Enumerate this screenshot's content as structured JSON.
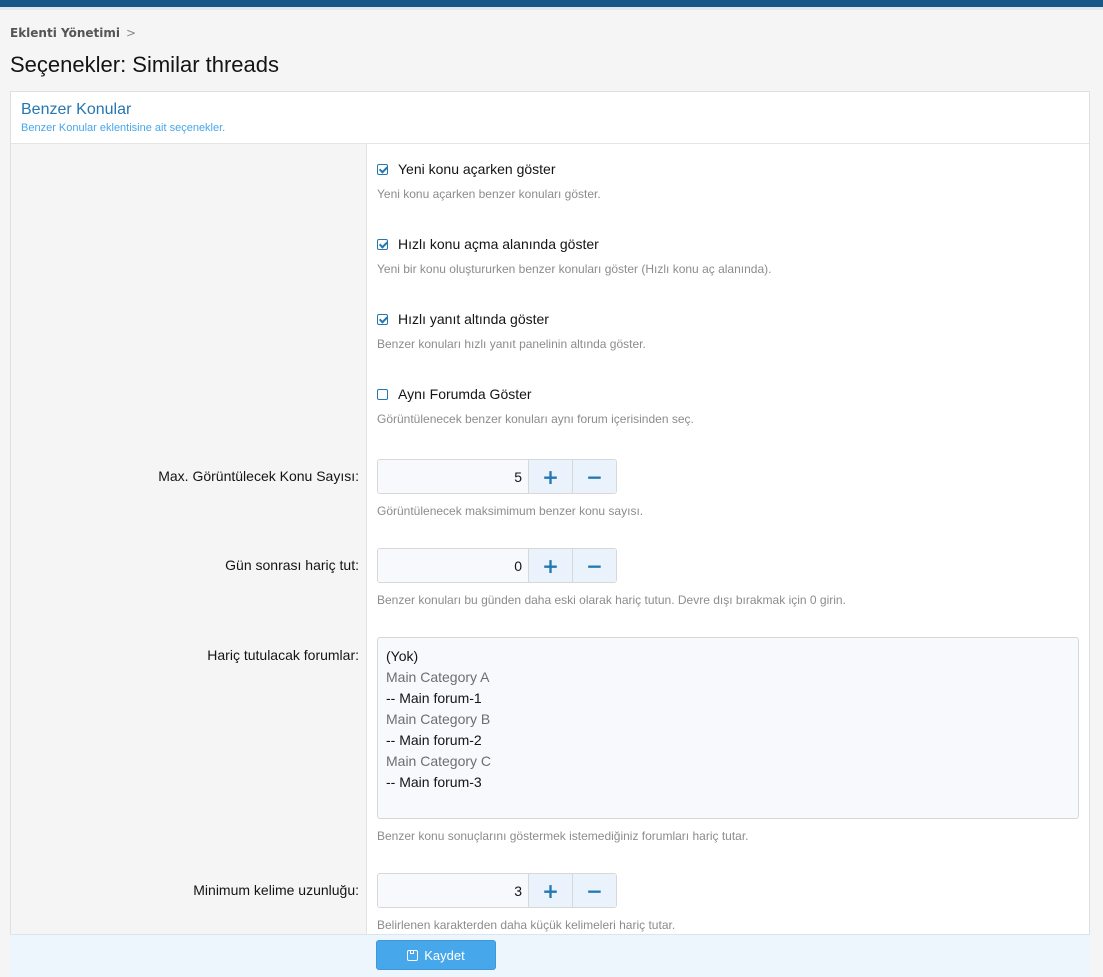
{
  "breadcrumb": {
    "item": "Eklenti Yönetimi",
    "separator": ">"
  },
  "page_title": "Seçenekler: Similar threads",
  "block": {
    "title": "Benzer Konular",
    "description": "Benzer Konular eklentisine ait seçenekler."
  },
  "checkboxes": [
    {
      "label": "Yeni konu açarken göster",
      "hint": "Yeni konu açarken benzer konuları göster.",
      "checked": true
    },
    {
      "label": "Hızlı konu açma alanında göster",
      "hint": "Yeni bir konu oluştururken benzer konuları göster (Hızlı konu aç alanında).",
      "checked": true
    },
    {
      "label": "Hızlı yanıt altında göster",
      "hint": "Benzer konuları hızlı yanıt panelinin altında göster.",
      "checked": true
    },
    {
      "label": "Aynı Forumda Göster",
      "hint": "Görüntülenecek benzer konuları aynı forum içerisinden seç.",
      "checked": false
    }
  ],
  "max_threads": {
    "label": "Max. Görüntülecek Konu Sayısı:",
    "value": "5",
    "hint": "Görüntülenecek maksimimum benzer konu sayısı."
  },
  "days_exclude": {
    "label": "Gün sonrası hariç tut:",
    "value": "0",
    "hint": "Benzer konuları bu günden daha eski olarak hariç tutun. Devre dışı bırakmak için 0 girin."
  },
  "excluded_forums": {
    "label": "Hariç tutulacak forumlar:",
    "options": [
      {
        "text": "(Yok)",
        "kind": "item"
      },
      {
        "text": "Main Category A",
        "kind": "cat"
      },
      {
        "text": "-- Main forum-1",
        "kind": "item"
      },
      {
        "text": "Main Category B",
        "kind": "cat"
      },
      {
        "text": "-- Main forum-2",
        "kind": "item"
      },
      {
        "text": "Main Category C",
        "kind": "cat"
      },
      {
        "text": "-- Main forum-3",
        "kind": "item"
      }
    ],
    "hint": "Benzer konu sonuçlarını göstermek istemediğiniz forumları hariç tutar."
  },
  "min_word": {
    "label": "Minimum kelime uzunluğu:",
    "value": "3",
    "hint": "Belirlenen karakterden daha küçük kelimeleri hariç tutar."
  },
  "spin": {
    "plus": "+",
    "minus": "−"
  },
  "save_label": "Kaydet",
  "colors": {
    "accent": "#2577b1",
    "button": "#47a7eb",
    "topbar": "#185886"
  }
}
